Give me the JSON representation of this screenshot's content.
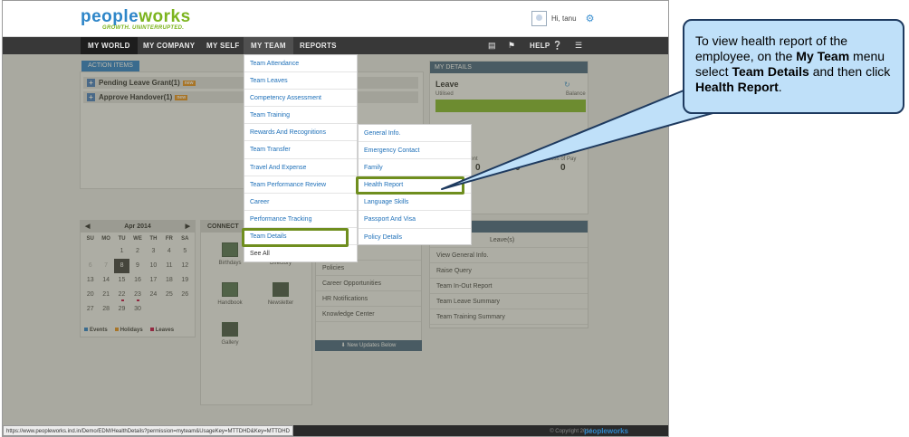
{
  "brand": {
    "logo_main_a": "peo",
    "logo_main_b": "ple",
    "logo_main_c": "works",
    "tagline": "GROWTH. UNINTERRUPTED."
  },
  "user": {
    "greeting": "Hi, tanu"
  },
  "nav": {
    "items": [
      "MY WORLD",
      "MY COMPANY",
      "MY SELF",
      "MY TEAM",
      "REPORTS"
    ],
    "help": "HELP"
  },
  "action": {
    "tab": "ACTION ITEMS",
    "rows": [
      {
        "label": "Pending Leave Grant(1)",
        "badge": "new"
      },
      {
        "label": "Approve Handover(1)",
        "badge": "new"
      }
    ]
  },
  "details": {
    "head": "MY DETAILS",
    "leave_title": "Leave",
    "availed": "Utilised",
    "balance": "Balance",
    "attendance_title": "ce",
    "att_labels": [
      "resent",
      "",
      "Loss of Pay"
    ],
    "att_values": [
      "0",
      "0",
      "0"
    ]
  },
  "calendar": {
    "month": "Apr 2014",
    "dow": [
      "SU",
      "MO",
      "TU",
      "WE",
      "TH",
      "FR",
      "SA"
    ],
    "weeks": [
      [
        "",
        "",
        "1",
        "2",
        "3",
        "4",
        "5"
      ],
      [
        "6",
        "7",
        "8",
        "9",
        "10",
        "11",
        "12"
      ],
      [
        "13",
        "14",
        "15",
        "16",
        "17",
        "18",
        "19"
      ],
      [
        "20",
        "21",
        "22",
        "23",
        "24",
        "25",
        "26"
      ],
      [
        "27",
        "28",
        "29",
        "30",
        "",
        "",
        ""
      ]
    ],
    "legend": [
      "Events",
      "Holidays",
      "Leaves"
    ]
  },
  "connect": {
    "head": "CONNECT",
    "items": [
      "Birthdays",
      "Directory",
      "Handbook",
      "Newsletter",
      "Gallery"
    ]
  },
  "news": {
    "items": [
      "etail",
      "Policies",
      "Career Opportunities",
      "HR Notifications",
      "Knowledge Center"
    ],
    "footer": "New Updates Below"
  },
  "quick": {
    "items": [
      "Leave(s)",
      "View General Info.",
      "Raise Query",
      "Team In-Out Report",
      "Team Leave Summary",
      "Team Training Summary"
    ]
  },
  "menu": {
    "items": [
      "Team Attendance",
      "Team Leaves",
      "Competency Assessment",
      "Team Training",
      "Rewards And Recognitions",
      "Team Transfer",
      "Travel And Expense",
      "Team Performance Review",
      "Career",
      "Performance Tracking",
      "Team Details",
      "See All"
    ]
  },
  "submenu": {
    "items": [
      "General Info.",
      "Emergency Contact",
      "Family",
      "Health Report",
      "Language Skills",
      "Passport And Visa",
      "Policy Details"
    ]
  },
  "status": {
    "url": "https://www.peopleworks.ind.in/Demo/EDM/HealthDetails?permission=myteam&UsageKey=MTTDHD&Key=MTTDHD",
    "copyright": "© Copyright 2014",
    "logo": "peopleworks"
  },
  "callout": {
    "t1": "To view health report of the employee, on the ",
    "b1": "My Team",
    "t2": " menu select ",
    "b2": "Team Details",
    "t3": " and then click ",
    "b3": "Health Report",
    "t4": "."
  },
  "colors": {
    "accent": "#2e86c8",
    "nav": "#383838",
    "highlight": "#6f8e1e",
    "callout": "#bfe0f9"
  }
}
